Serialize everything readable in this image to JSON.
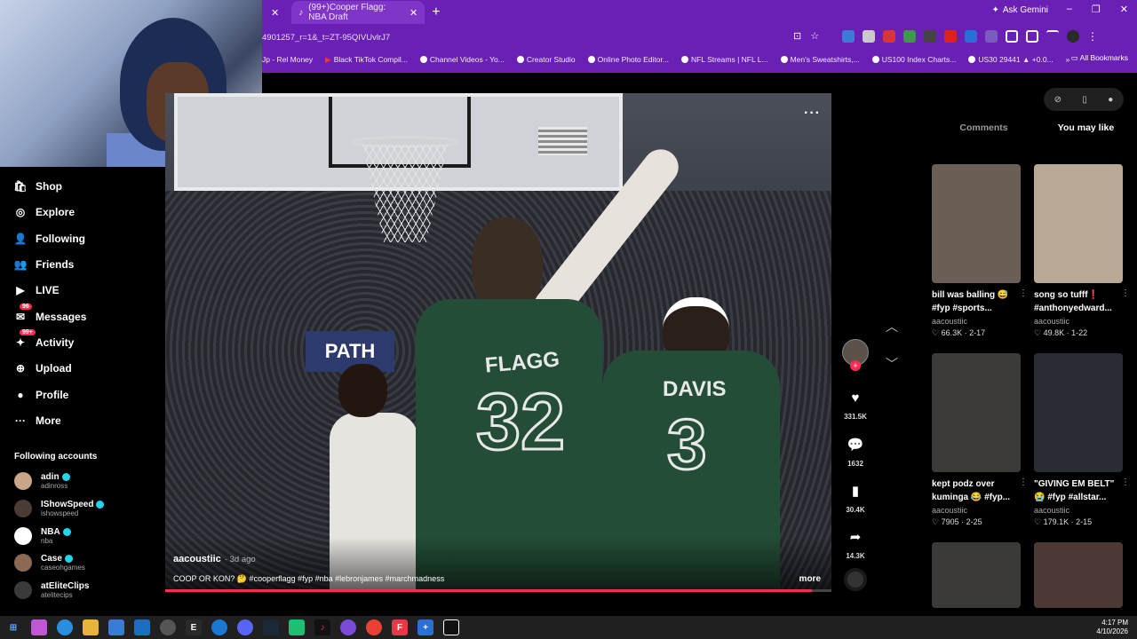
{
  "browser": {
    "tabs": [
      {
        "label": "(99+)Cooper Flagg: NBA Draft",
        "active": true
      }
    ],
    "new_tab": "+",
    "gemini": "Ask Gemini",
    "address": "4901257_r=1&_t=ZT-95QIVUvlrJ7",
    "bookmarks": [
      "Jp - Rel Money",
      "Black TikTok Compil...",
      "Channel Videos - Yo...",
      "Creator Studio",
      "Online Photo Editor...",
      "NFL Streams | NFL L...",
      "Men's Sweatshirts,...",
      "US100 Index Charts...",
      "US30 29441 ▲ +0.0..."
    ],
    "bookmarks_more": "»",
    "all_bookmarks": "All Bookmarks",
    "window_controls": [
      "–",
      "❐",
      "✕"
    ]
  },
  "sidebar": {
    "items": [
      {
        "label": "Shop",
        "icon": "shop-icon",
        "glyph": "🛍"
      },
      {
        "label": "Explore",
        "icon": "compass-icon",
        "glyph": "◎"
      },
      {
        "label": "Following",
        "icon": "person-icon",
        "glyph": "👤"
      },
      {
        "label": "Friends",
        "icon": "friends-icon",
        "glyph": "👥"
      },
      {
        "label": "LIVE",
        "icon": "live-icon",
        "glyph": "▶"
      },
      {
        "label": "Messages",
        "icon": "messages-icon",
        "glyph": "✉",
        "badge": "96"
      },
      {
        "label": "Activity",
        "icon": "activity-icon",
        "glyph": "✦",
        "badge": "99+"
      },
      {
        "label": "Upload",
        "icon": "upload-icon",
        "glyph": "⊕"
      },
      {
        "label": "Profile",
        "icon": "profile-icon",
        "glyph": "●"
      },
      {
        "label": "More",
        "icon": "more-icon",
        "glyph": "···"
      }
    ],
    "following_title": "Following accounts",
    "accounts": [
      {
        "name": "adin",
        "handle": "adinross",
        "color": "#c9a58a"
      },
      {
        "name": "IShowSpeed",
        "handle": "ishowspeed",
        "color": "#4a3b35"
      },
      {
        "name": "NBA",
        "handle": "nba",
        "color": "#ffffff"
      },
      {
        "name": "Case",
        "handle": "caseohgames",
        "color": "#8a6a55"
      },
      {
        "name": "atEliteClips",
        "handle": "atelitecips",
        "color": "#3a3a3a"
      }
    ]
  },
  "video": {
    "author": "aacoustiic",
    "date": "· 3d ago",
    "caption": "COOP OR KON? 🤔 #cooperflagg #fyp #nba #lebronjames #marchmadness",
    "more": "more",
    "jersey1_name": "FLAGG",
    "jersey1_number": "32",
    "jersey2_name": "DAVIS",
    "jersey2_number": "3",
    "sign": "PATH",
    "menu": "···",
    "progress": 0.97
  },
  "actions": {
    "likes": "331.5K",
    "comments": "1632",
    "saves": "30.4K",
    "shares": "14.3K",
    "follow": "+"
  },
  "right_panel": {
    "tabs": [
      "Comments",
      "You may like"
    ],
    "active_tab": "You may like",
    "cards": [
      {
        "title": "bill was balling 😅 #fyp #sports...",
        "author": "aacoustiic",
        "stats": "♡ 66.3K · 2-17",
        "color": "#6b5f55"
      },
      {
        "title": "song so tufff❗ #anthonyedward...",
        "author": "aacoustiic",
        "stats": "♡ 49.8K · 1-22",
        "color": "#b9a995"
      },
      {
        "title": "kept podz over kuminga 😂 #fyp...",
        "author": "aacoustiic",
        "stats": "♡ 7905 · 2-25",
        "color": "#3d3b38"
      },
      {
        "title": "\"GIVING EM BELT\" 😭 #fyp #allstar...",
        "author": "aacoustiic",
        "stats": "♡ 179.1K · 2-15",
        "color": "#2a2c34"
      },
      {
        "title": "",
        "author": "",
        "stats": "",
        "color": "#3b3a36"
      },
      {
        "title": "",
        "author": "",
        "stats": "",
        "color": "#4a3a33"
      }
    ]
  },
  "taskbar": {
    "time": "4:17 PM",
    "date": "4/10/2026"
  }
}
